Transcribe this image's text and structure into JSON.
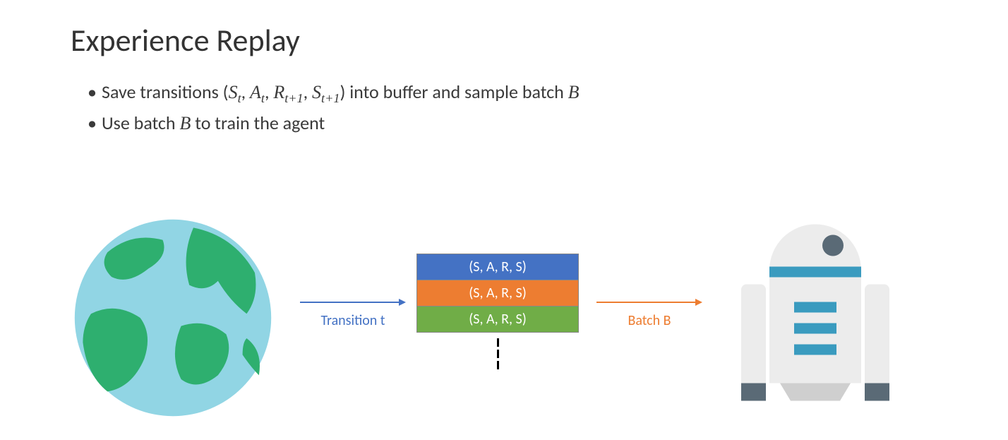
{
  "title": "Experience Replay",
  "bullets": {
    "b1_pre": "Save transitions  (",
    "b1_s": "S",
    "b1_a": "A",
    "b1_r": "R",
    "b1_sub_t": "t",
    "b1_sub_t1": "t+1",
    "b1_post": ") into buffer and sample batch ",
    "b1_B": "B",
    "b2_pre": "Use batch ",
    "b2_B": "B",
    "b2_post": " to train the agent"
  },
  "diagram": {
    "arrow1_label": "Transition t",
    "arrow2_label": "Batch B",
    "buffer_rows": {
      "r0": "(S, A, R, S)",
      "r1": "(S, A, R, S)",
      "r2": "(S, A, R, S)"
    },
    "colors": {
      "arrow1": "#4472c4",
      "arrow2": "#ed7d31",
      "row_blue": "#4472c4",
      "row_orange": "#ed7d31",
      "row_green": "#70ad47",
      "globe_water": "#91d5e4",
      "globe_land": "#2eaf6f",
      "robot_body": "#ececec",
      "robot_accent": "#3a9bbf",
      "robot_dark": "#5a6a76"
    }
  }
}
